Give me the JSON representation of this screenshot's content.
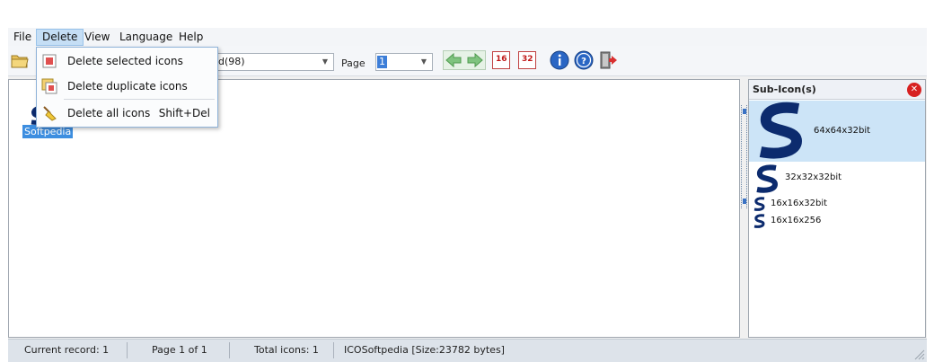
{
  "menubar": {
    "items": [
      "File",
      "Delete",
      "View",
      "Language",
      "Help"
    ],
    "active": "Delete"
  },
  "toolbar": {
    "record_combo_value": "d(98)",
    "page_label": "Page",
    "page_value": "1",
    "size16_label": "16",
    "size32_label": "32"
  },
  "delete_menu": {
    "items": [
      {
        "label": "Delete selected icons",
        "shortcut": ""
      },
      {
        "label": "Delete duplicate icons",
        "shortcut": ""
      },
      {
        "label": "Delete all icons",
        "shortcut": "Shift+Del"
      }
    ]
  },
  "main": {
    "selected_icon_label": "Softpedia"
  },
  "sub_icons": {
    "title": "Sub-Icon(s)",
    "items": [
      {
        "label": "64x64x32bit"
      },
      {
        "label": "32x32x32bit"
      },
      {
        "label": "16x16x32bit"
      },
      {
        "label": "16x16x256"
      }
    ]
  },
  "status": {
    "current_record": "Current record: 1",
    "page": "Page 1 of 1",
    "total": "Total icons: 1",
    "file_info": "ICOSoftpedia [Size:23782 bytes]"
  },
  "colors": {
    "accent": "#3d8ee0",
    "brand_s": "#0c2b6e",
    "close_red": "#d72020"
  }
}
